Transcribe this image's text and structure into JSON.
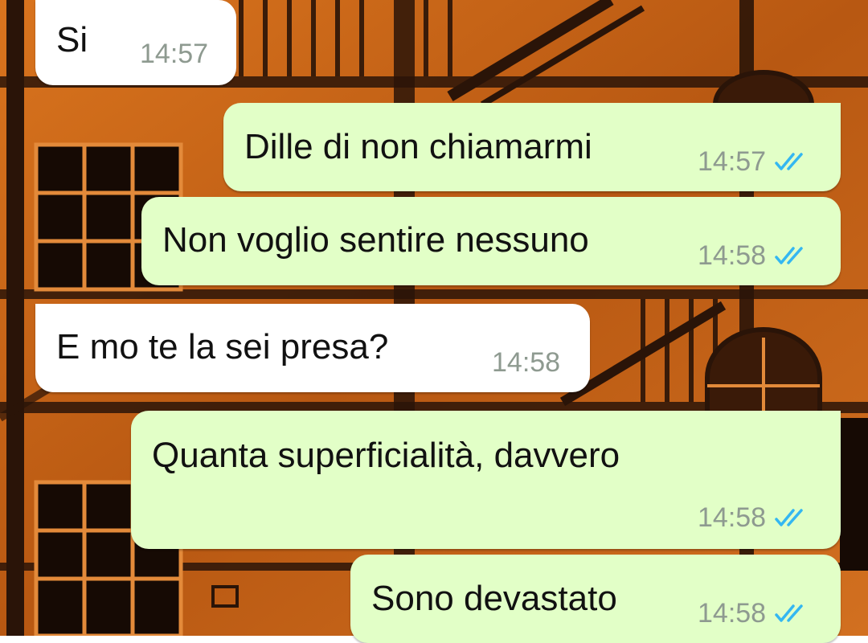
{
  "chat": {
    "colors": {
      "incoming_bubble": "#ffffff",
      "outgoing_bubble": "#e2ffc7",
      "read_ticks": "#34b7f1",
      "timestamp": "#8e9a90",
      "wallpaper": "#c8641a"
    },
    "messages": [
      {
        "direction": "incoming",
        "text": "Si",
        "time": "14:57"
      },
      {
        "direction": "outgoing",
        "text": "Dille di non chiamarmi",
        "time": "14:57",
        "status_icon": "double-check-icon"
      },
      {
        "direction": "outgoing",
        "text": "Non voglio sentire nessuno",
        "time": "14:58",
        "status_icon": "double-check-icon"
      },
      {
        "direction": "incoming",
        "text": "E mo te la sei presa?",
        "time": "14:58"
      },
      {
        "direction": "outgoing",
        "text": "Quanta superficialità, davvero",
        "time": "14:58",
        "status_icon": "double-check-icon"
      },
      {
        "direction": "outgoing",
        "text": "Sono devastato",
        "time": "14:58",
        "status_icon": "double-check-icon"
      }
    ]
  }
}
